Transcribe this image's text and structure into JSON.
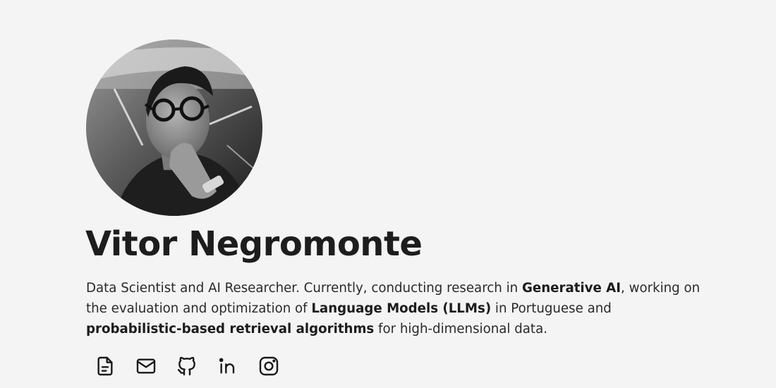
{
  "profile": {
    "name": "Vitor Negromonte",
    "bio": [
      {
        "text": "Data Scientist and AI Researcher. Currently, conducting research in ",
        "bold": false
      },
      {
        "text": "Generative AI",
        "bold": true
      },
      {
        "text": ", working on the evaluation and optimization of ",
        "bold": false
      },
      {
        "text": "Language Models (LLMs)",
        "bold": true
      },
      {
        "text": " in Portuguese and ",
        "bold": false
      },
      {
        "text": "probabilistic-based retrieval algorithms",
        "bold": true
      },
      {
        "text": " for high-dimensional data.",
        "bold": false
      }
    ]
  },
  "socials": [
    {
      "icon": "document-icon"
    },
    {
      "icon": "mail-icon"
    },
    {
      "icon": "github-icon"
    },
    {
      "icon": "linkedin-icon"
    },
    {
      "icon": "instagram-icon"
    }
  ],
  "colors": {
    "background": "#f4f4f4",
    "text": "#222222"
  }
}
